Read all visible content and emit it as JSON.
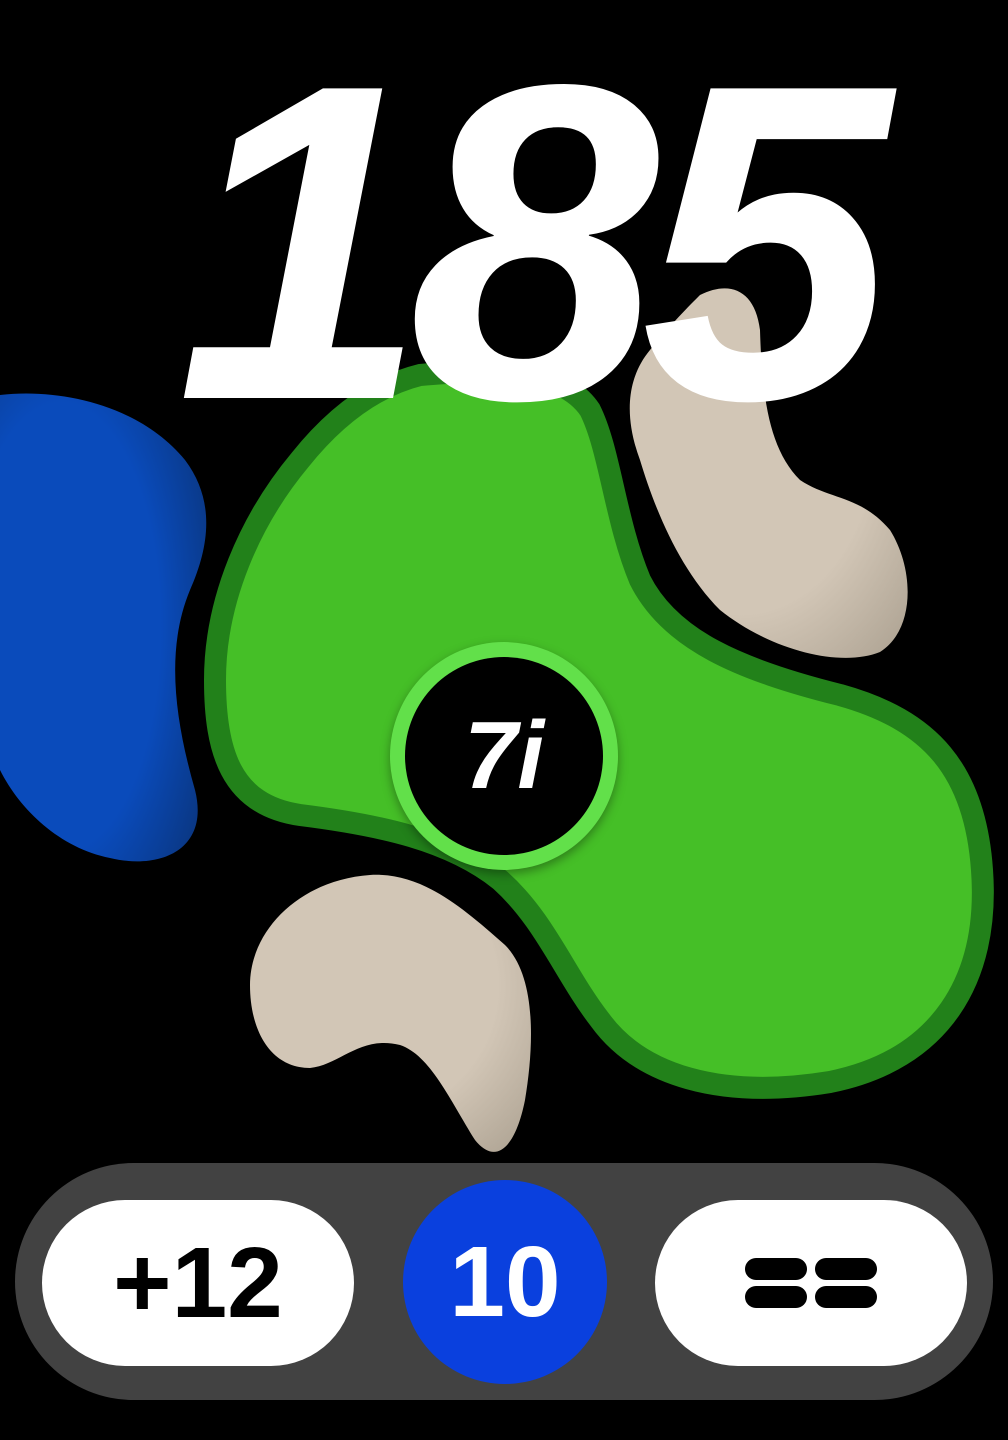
{
  "distance": {
    "value": "185"
  },
  "club": {
    "label": "7i"
  },
  "bottom_bar": {
    "score": "+12",
    "hole": "10",
    "menu_icon": "menu-grid-icon"
  },
  "colors": {
    "green": "#45bf27",
    "green_border": "#22811a",
    "water": "#0a48b8",
    "sand": "#d2c6b6",
    "hole_badge": "#0a40de",
    "bar": "#424242"
  }
}
